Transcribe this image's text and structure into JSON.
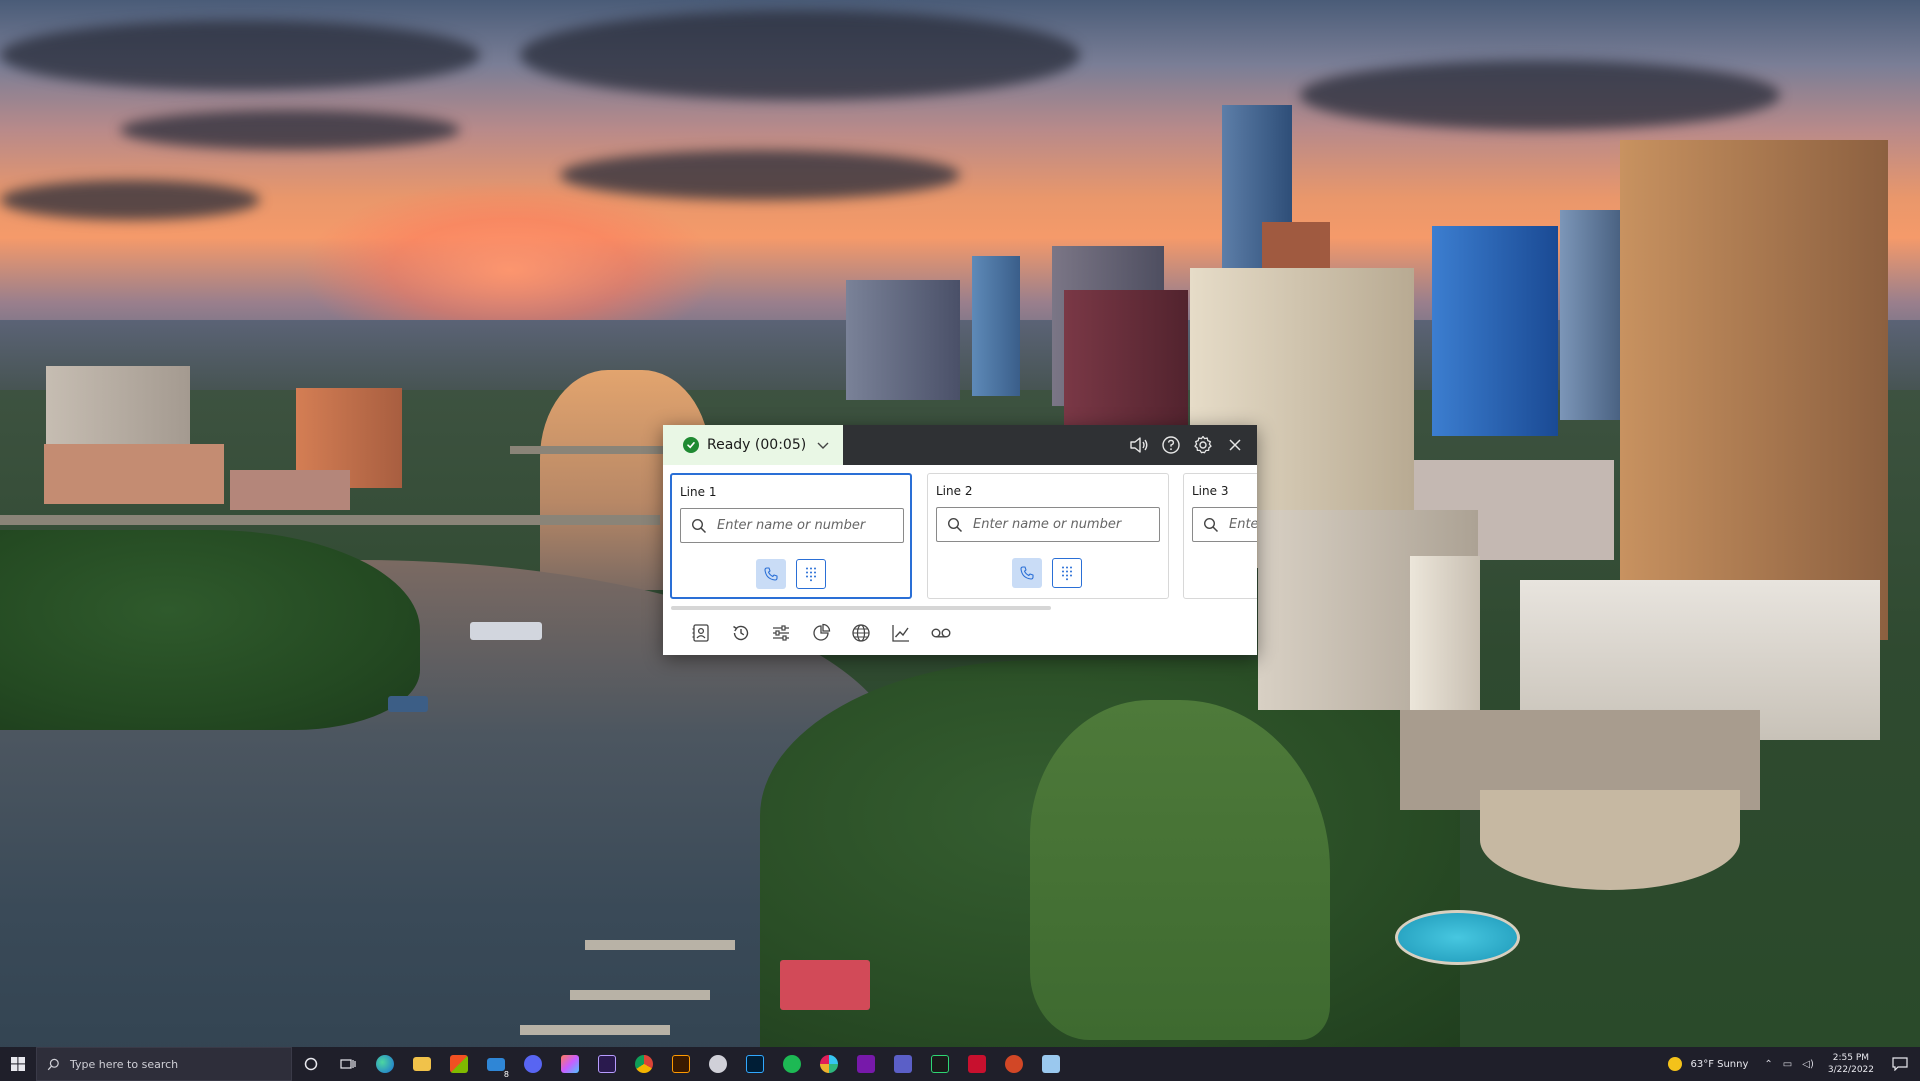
{
  "phone_app": {
    "status": {
      "label": "Ready (00:05)",
      "color": "#1f8a32"
    },
    "title_icons": [
      "speaker-icon",
      "help-icon",
      "settings-icon",
      "close-icon"
    ],
    "lines": [
      {
        "title": "Line 1",
        "placeholder": "Enter name or number",
        "active": true
      },
      {
        "title": "Line 2",
        "placeholder": "Enter name or number",
        "active": false
      },
      {
        "title": "Line 3",
        "placeholder": "Enter name or number",
        "active": false
      }
    ],
    "toolbar": [
      "contacts-icon",
      "history-icon",
      "settings-sliders-icon",
      "reports-icon",
      "web-icon",
      "analytics-icon",
      "voicemail-icon"
    ],
    "accent_color": "#2a6fd6"
  },
  "taskbar": {
    "search_placeholder": "Type here to search",
    "weather": "63°F  Sunny",
    "time": "2:55 PM",
    "date": "3/22/2022",
    "mail_badge": "8"
  }
}
